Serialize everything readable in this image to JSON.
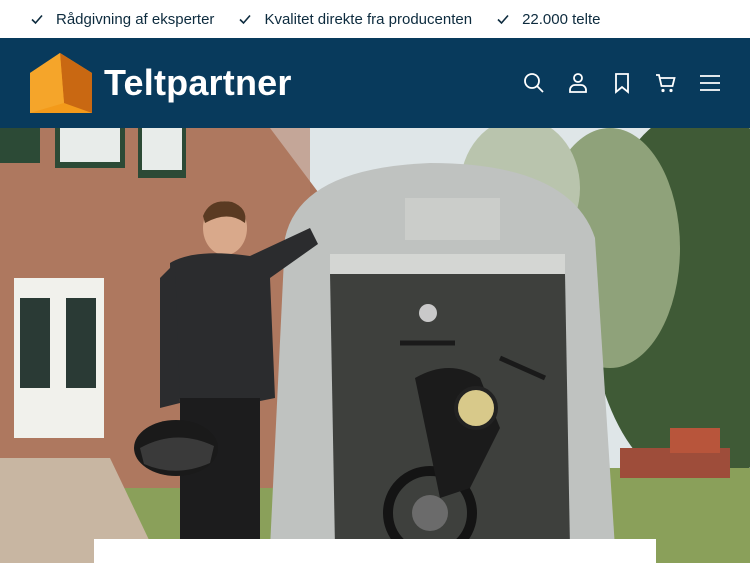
{
  "usps": [
    {
      "icon": "check-icon",
      "text": "Rådgivning af eksperter"
    },
    {
      "icon": "check-icon",
      "text": "Kvalitet direkte fra producenten"
    },
    {
      "icon": "check-icon",
      "text": "22.000 telte"
    }
  ],
  "header": {
    "brand": "Teltpartner",
    "icons": [
      "search-icon",
      "user-icon",
      "bookmark-icon",
      "cart-icon",
      "menu-icon"
    ]
  },
  "colors": {
    "header_bg": "#083a5c",
    "brand_orange": "#f39a1a",
    "brand_orange_dark": "#c96812"
  }
}
